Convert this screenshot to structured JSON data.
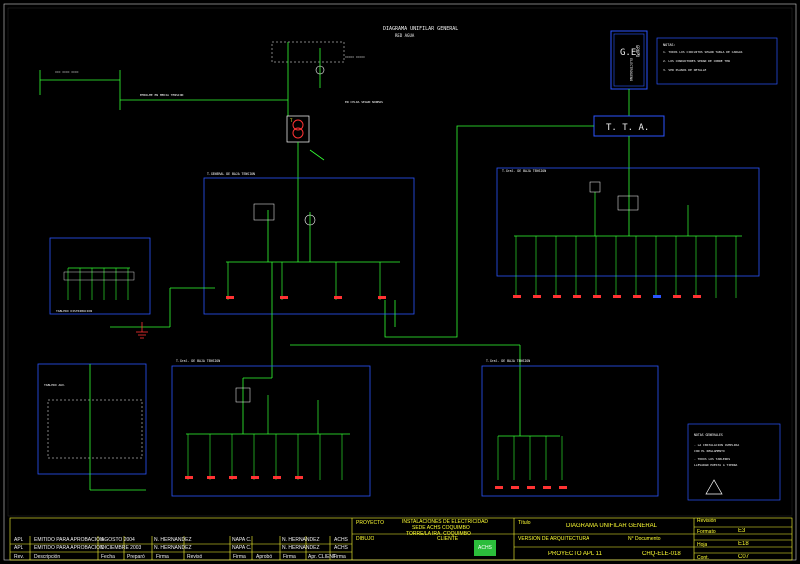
{
  "drawing": {
    "title": "DIAGRAMA UNIFILAR GENERAL",
    "subtitle": "RED AGUA",
    "gen_box": {
      "line1": "G.E.",
      "line2": "GRUPO",
      "line3": "ELECTROGENO"
    },
    "tta_label": "T.  T.  A.",
    "transformer_label": "T",
    "notes_top": [
      "NOTAS:",
      "1. TODOS LOS CIRCUITOS SEGUN TABLA DE CARGAS",
      "2. LOS CONDUCTORES SERAN DE COBRE THW",
      "3. VER PLANOS DE DETALLE"
    ],
    "notes_bottom": [
      "NOTAS GENERALES",
      "- LA INSTALACION CUMPLIRA",
      "  CON EL REGLAMENTO",
      "- TODOS LOS TABLEROS",
      "  LLEVARAN PUESTA A TIERRA"
    ],
    "board_labels": {
      "main": "T.GENERAL DE BAJA TENSION",
      "right": "T.Gral. DE BAJA TENSION",
      "left_small": "TABLERO DISTRIBUCION",
      "bl": "T.Gral. DE BAJA TENSION",
      "br": "T.Gral. DE BAJA TENSION",
      "far_left": "TABLERO AUX."
    }
  },
  "title_block": {
    "rev_rows": [
      {
        "rev": "APL",
        "desc": "EMITIDO PARA APROBACION",
        "date": "AGOSTO 2004",
        "prep": "N. HERNANDEZ",
        "rev_by": "NAPA C.",
        "apr": "N. HERNANDEZ",
        "client": "ACHS"
      },
      {
        "rev": "APL",
        "desc": "EMITIDO PARA APROBACION",
        "date": "DICIEMBRE 2003",
        "prep": "N. HERNANDEZ",
        "rev_by": "NAPA C.",
        "apr": "N. HERNANDEZ",
        "client": "ACHS"
      }
    ],
    "header_cols": [
      "Rev.",
      "Descripción",
      "Fecha",
      "Preparó",
      "Firma",
      "Revisó",
      "Firma",
      "Aprobó",
      "Firma",
      "Apr. CLIENT",
      "Firma"
    ],
    "proyecto_label": "PROYECTO",
    "proyecto_value": [
      "INSTALACIONES DE ELECTRICIDAD",
      "SEDE ACHS COQUIMBO",
      "TORRE/LA IRA. COQUIMBO"
    ],
    "dibujo_label": "DIBUJO",
    "cliente_label": "CLIENTE",
    "logo_text": "ACHS",
    "titulo_label": "Título",
    "titulo_value": "DIAGRAMA UNIFILAR GENERAL",
    "version_label": "VERSION DE ARQUITECTURA",
    "proyecto_code": "PROYECTO APL 11",
    "ndoc_label": "N° Documento",
    "ndoc_value": "CHQ-ELE-018",
    "revision_label": "Revisión",
    "revision_value": "",
    "formato_label": "Formato",
    "formato_value": "E3",
    "hoja_label": "Hoja",
    "hoja_value": "E18",
    "cont_label": "Cont.",
    "cont_value": "C07"
  }
}
